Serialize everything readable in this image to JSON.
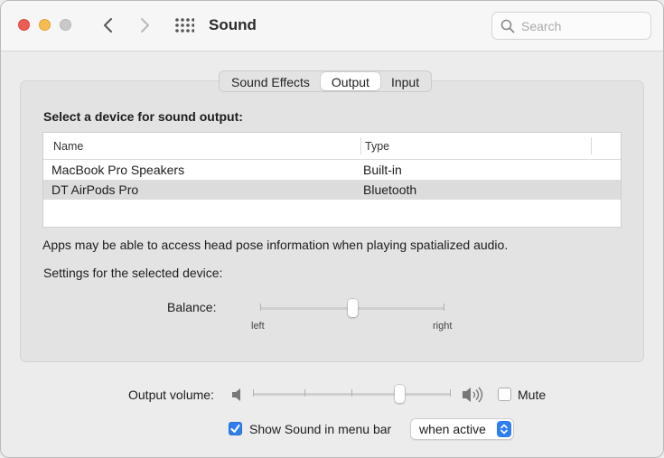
{
  "window": {
    "title": "Sound"
  },
  "search": {
    "placeholder": "Search"
  },
  "tabs": [
    {
      "label": "Sound Effects",
      "selected": false
    },
    {
      "label": "Output",
      "selected": true
    },
    {
      "label": "Input",
      "selected": false
    }
  ],
  "output": {
    "heading": "Select a device for sound output:",
    "columns": [
      "Name",
      "Type"
    ],
    "devices": [
      {
        "name": "MacBook Pro Speakers",
        "type": "Built-in",
        "selected": false
      },
      {
        "name": "DT AirPods Pro",
        "type": "Bluetooth",
        "selected": true
      }
    ],
    "note": "Apps may be able to access head pose information when playing spatialized audio.",
    "settings_label": "Settings for the selected device:",
    "balance": {
      "label": "Balance:",
      "left_label": "left",
      "right_label": "right",
      "value": 0.5
    }
  },
  "volume": {
    "label": "Output volume:",
    "value": 0.74,
    "mute_label": "Mute",
    "muted": false
  },
  "menu_bar": {
    "label": "Show Sound in menu bar",
    "checked": true,
    "option": "when active"
  },
  "colors": {
    "accent": "#2e7ef0",
    "close": "#ee5e57",
    "minimize": "#f5bd4f",
    "zoom_disabled": "#c9c9c9"
  }
}
